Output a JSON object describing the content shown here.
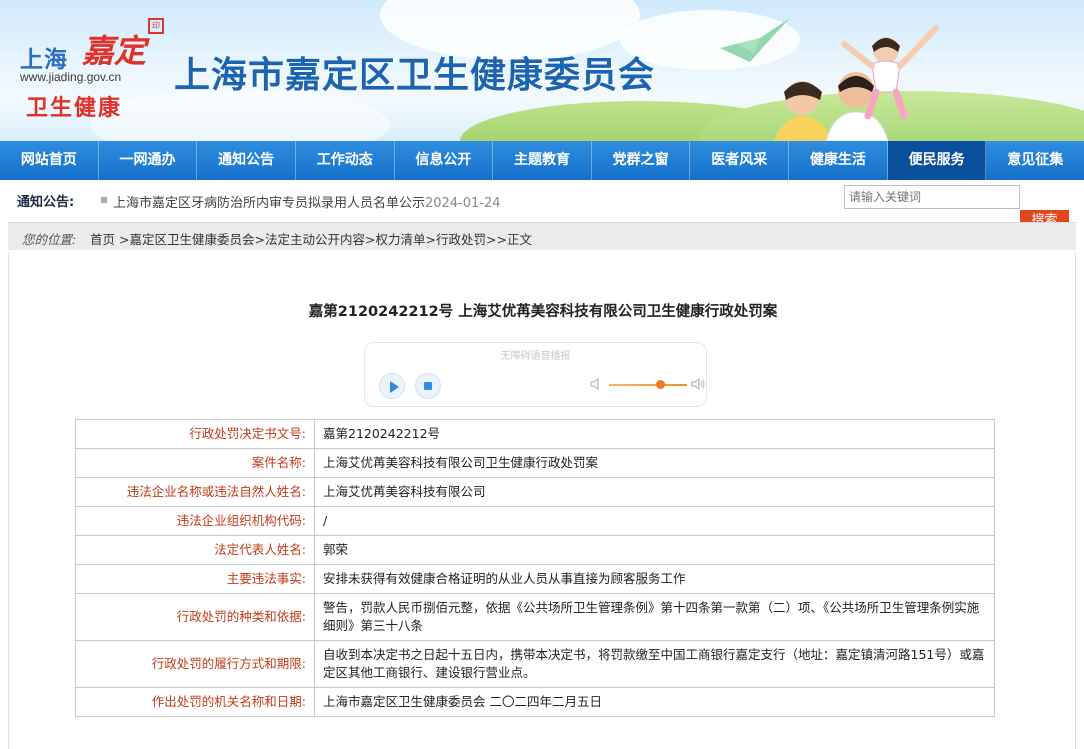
{
  "header": {
    "logo_city": "上海",
    "logo_district": "嘉定",
    "logo_url": "www.jiading.gov.cn",
    "logo_sub": "卫生健康",
    "site_title": "上海市嘉定区卫生健康委员会"
  },
  "nav": {
    "items": [
      "网站首页",
      "一网通办",
      "通知公告",
      "工作动态",
      "信息公开",
      "主题教育",
      "党群之窗",
      "医者风采",
      "健康生活",
      "便民服务",
      "意见征集"
    ],
    "active_index": 9
  },
  "notice": {
    "label": "通知公告:",
    "text": "上海市嘉定区牙病防治所内审专员拟录用人员名单公示",
    "date": "2024-01-24"
  },
  "search": {
    "placeholder": "请输入关键词",
    "button_label": "搜索"
  },
  "breadcrumb": {
    "label": "您的位置:",
    "path": [
      "首页",
      "嘉定区卫生健康委员会",
      "法定主动公开内容",
      "权力清单",
      "行政处罚",
      ">正文"
    ]
  },
  "document": {
    "title": "嘉第2120242212号  上海艾优苒美容科技有限公司卫生健康行政处罚案",
    "player_caption": "无障碍语音播报",
    "volume_level": 0.65,
    "rows": [
      {
        "key": "行政处罚决定书文号:",
        "value": "嘉第2120242212号"
      },
      {
        "key": "案件名称:",
        "value": "上海艾优苒美容科技有限公司卫生健康行政处罚案"
      },
      {
        "key": "违法企业名称或违法自然人姓名:",
        "value": "上海艾优苒美容科技有限公司"
      },
      {
        "key": "违法企业组织机构代码:",
        "value": "/"
      },
      {
        "key": "法定代表人姓名:",
        "value": "郭荣"
      },
      {
        "key": "主要违法事实:",
        "value": "安排未获得有效健康合格证明的从业人员从事直接为顾客服务工作"
      },
      {
        "key": "行政处罚的种类和依据:",
        "value": "警告，罚款人民币捌佰元整，依据《公共场所卫生管理条例》第十四条第一款第（二）项、《公共场所卫生管理条例实施细则》第三十八条"
      },
      {
        "key": "行政处罚的履行方式和期限:",
        "value": "自收到本决定书之日起十五日内，携带本决定书，将罚款缴至中国工商银行嘉定支行（地址：嘉定镇清河路151号）或嘉定区其他工商银行、建设银行营业点。"
      },
      {
        "key": "作出处罚的机关名称和日期:",
        "value": "上海市嘉定区卫生健康委员会  二〇二四年二月五日"
      }
    ]
  },
  "colors": {
    "nav_blue": "#1570c8",
    "nav_active": "#0a4f9c",
    "title_blue": "#1c64b0",
    "label_red": "#c23a1a",
    "search_orange": "#e2471f"
  }
}
